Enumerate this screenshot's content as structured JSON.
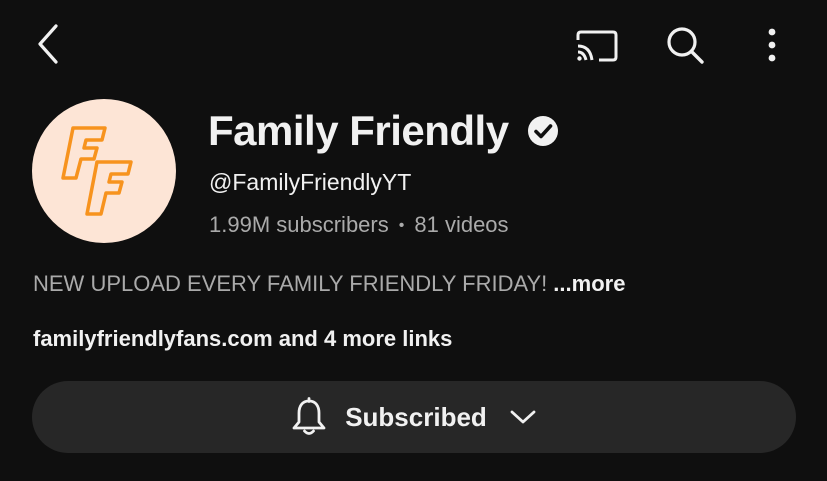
{
  "channel": {
    "name": "Family Friendly",
    "handle": "@FamilyFriendlyYT",
    "subscribers": "1.99M subscribers",
    "separator": "•",
    "videos": "81 videos",
    "avatar_initials": "FF",
    "verified": true
  },
  "description": {
    "text": "NEW UPLOAD EVERY FAMILY FRIENDLY FRIDAY!",
    "more_label": "...more"
  },
  "links": {
    "primary": "familyfriendlyfans.com",
    "rest": " and 4 more links"
  },
  "subscribe_button": {
    "label": "Subscribed"
  },
  "icons": {
    "back": "chevron-left-icon",
    "cast": "cast-icon",
    "search": "search-icon",
    "more": "more-vertical-icon",
    "bell": "bell-icon",
    "dropdown": "chevron-down-icon",
    "verified": "verified-check-icon"
  },
  "colors": {
    "background": "#0f0f0f",
    "text_primary": "#f1f1f1",
    "text_secondary": "#aaaaaa",
    "button_bg": "#272727",
    "avatar_bg": "#fde5d6",
    "avatar_accent": "#f7931e"
  }
}
